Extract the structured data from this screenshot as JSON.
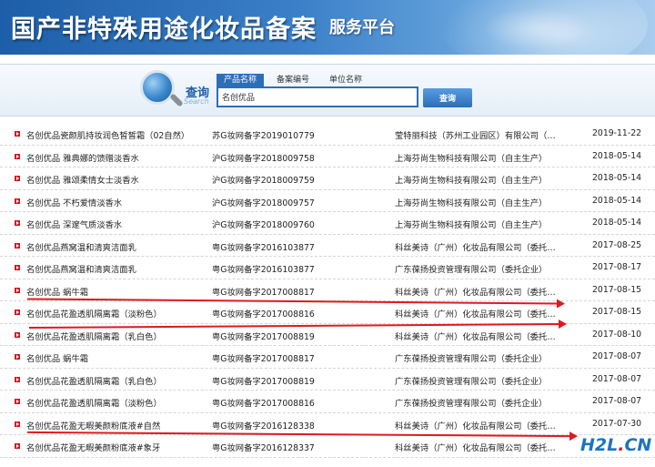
{
  "banner": {
    "title": "国产非特殊用途化妆品备案",
    "subtitle": "服务平台"
  },
  "search": {
    "icon_label": "查询",
    "icon_label_en": "Search",
    "tabs": [
      {
        "label": "产品名称",
        "active": true
      },
      {
        "label": "备案编号",
        "active": false
      },
      {
        "label": "单位名称",
        "active": false
      }
    ],
    "query_value": "名创优品",
    "button_label": "查询"
  },
  "results": [
    {
      "name": "名创优品瓷颜肌持妆润色皙皙霜（02自然）",
      "reg": "苏G妆网备字2019010779",
      "company": "莹特丽科技（苏州工业园区）有限公司（…",
      "date": "2019-11-22"
    },
    {
      "name": "名创优品 雅典娜的馈赠淡香水",
      "reg": "沪G妆网备字2018009758",
      "company": "上海芬尚生物科技有限公司（自主生产）",
      "date": "2018-05-14"
    },
    {
      "name": "名创优品 雅颂柔情女士淡香水",
      "reg": "沪G妆网备字2018009759",
      "company": "上海芬尚生物科技有限公司（自主生产）",
      "date": "2018-05-14"
    },
    {
      "name": "名创优品 不朽爱情淡香水",
      "reg": "沪G妆网备字2018009757",
      "company": "上海芬尚生物科技有限公司（自主生产）",
      "date": "2018-05-14"
    },
    {
      "name": "名创优品 深邃气质淡香水",
      "reg": "沪G妆网备字2018009760",
      "company": "上海芬尚生物科技有限公司（自主生产）",
      "date": "2018-05-14"
    },
    {
      "name": "名创优品燕窝温和清爽洁面乳",
      "reg": "粤G妆网备字2016103877",
      "company": "科丝美诗（广州）化妆品有限公司（委托…",
      "date": "2017-08-25"
    },
    {
      "name": "名创优品燕窝温和清爽洁面乳",
      "reg": "粤G妆网备字2016103877",
      "company": "广东葆扬投资管理有限公司（委托企业）",
      "date": "2017-08-17"
    },
    {
      "name": "名创优品 蜗牛霜",
      "reg": "粤G妆网备字2017008817",
      "company": "科丝美诗（广州）化妆品有限公司（委托…",
      "date": "2017-08-15"
    },
    {
      "name": "名创优品花盈透肌隔离霜（淡粉色）",
      "reg": "粤G妆网备字2017008816",
      "company": "科丝美诗（广州）化妆品有限公司（委托…",
      "date": "2017-08-15"
    },
    {
      "name": "名创优品花盈透肌隔离霜（乳白色）",
      "reg": "粤G妆网备字2017008819",
      "company": "科丝美诗（广州）化妆品有限公司（委托…",
      "date": "2017-08-10"
    },
    {
      "name": "名创优品 蜗牛霜",
      "reg": "粤G妆网备字2017008817",
      "company": "广东葆扬投资管理有限公司（委托企业）",
      "date": "2017-08-07"
    },
    {
      "name": "名创优品花盈透肌隔离霜（乳白色）",
      "reg": "粤G妆网备字2017008819",
      "company": "广东葆扬投资管理有限公司（委托企业）",
      "date": "2017-08-07"
    },
    {
      "name": "名创优品花盈透肌隔离霜（淡粉色）",
      "reg": "粤G妆网备字2017008816",
      "company": "广东葆扬投资管理有限公司（委托企业）",
      "date": "2017-08-07"
    },
    {
      "name": "名创优品花盈无暇美颜粉底液#自然",
      "reg": "粤G妆网备字2016128338",
      "company": "科丝美诗（广州）化妆品有限公司（委托…",
      "date": "2017-07-30"
    },
    {
      "name": "名创优品花盈无暇美颜粉底液#象牙",
      "reg": "粤G妆网备字2016128337",
      "company": "科丝美诗（广州）化妆品有限公司（委托…",
      "date": ""
    }
  ],
  "watermark": {
    "main": "H2L",
    "dot": ".",
    "tld": "CN"
  },
  "colors": {
    "accent": "#2b6fb8",
    "bullet": "#d0161e",
    "annotation": "#e0191f"
  }
}
